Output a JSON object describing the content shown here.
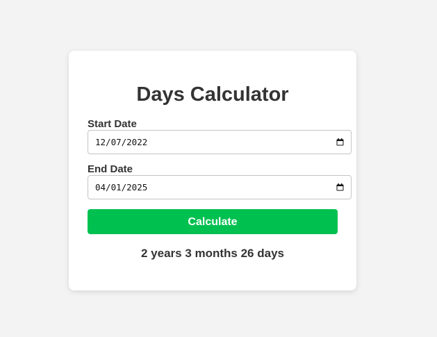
{
  "calculator": {
    "title": "Days Calculator",
    "start_label": "Start Date",
    "start_value": "12/07/2022",
    "end_label": "End Date",
    "end_value": "04/01/2025",
    "button_label": "Calculate",
    "result": "2 years 3 months 26 days"
  },
  "colors": {
    "background": "#f3f3f3",
    "card": "#ffffff",
    "button": "#00c050",
    "text": "#333333"
  },
  "icons": {
    "date_picker": "calendar-icon"
  }
}
